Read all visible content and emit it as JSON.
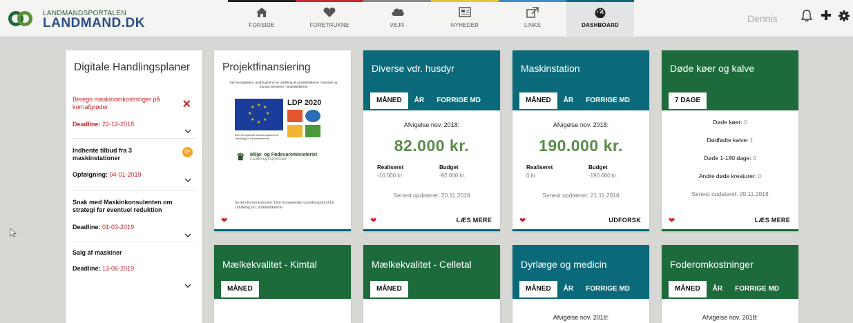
{
  "header": {
    "logo_top": "LANDMANDSPORTALEN",
    "logo_main": "LANDMAND.DK",
    "user": "Dennis",
    "nav": [
      {
        "label": "FORSIDE",
        "icon": "home-icon",
        "color": "#222222"
      },
      {
        "label": "FORETRUKNE",
        "icon": "heart-icon",
        "color": "#d0272b"
      },
      {
        "label": "VEJR",
        "icon": "cloud-icon",
        "color": "#7a7a7a"
      },
      {
        "label": "NYHEDER",
        "icon": "newspaper-icon",
        "color": "#e8c53a"
      },
      {
        "label": "LINKS",
        "icon": "external-link-icon",
        "color": "#3b8ed0"
      },
      {
        "label": "DASHBOARD",
        "icon": "dashboard-icon",
        "color": "#0b6a7a"
      }
    ]
  },
  "plans": {
    "title": "Digitale Handlingsplaner",
    "items": [
      {
        "text": "Beregn maskinomkostninger på kornafgrøder",
        "deadline_label": "Deadline:",
        "deadline": "22-12-2018"
      },
      {
        "text": "Indhente tilbud fra 3 maskinstationer",
        "deadline_label": "Opfølgning:",
        "deadline": "04-01-2019"
      },
      {
        "text": "Snak med Maskinkonsulenten om strategi for eventuel reduktion",
        "deadline_label": "Deadline:",
        "deadline": "01-03-2019"
      },
      {
        "text": "Salg af maskiner",
        "deadline_label": "Deadline:",
        "deadline": "13-06-2019"
      }
    ]
  },
  "proj": {
    "title": "Projektfinansiering",
    "eu_title": "Den Europæiske Landbrugsfond for Udvikling af Landdistrikterne: Danmark og Europa investerer i landdistrikterne",
    "flag_caption": "Den Europæiske Landbrugsfond for Udvikling af Landdistrikterne",
    "ldp": "LDP 2020",
    "ministry": "Miljø- og Fødevareministeriet",
    "agency": "Landbrugsstyrelsen",
    "note": "Se EU-Kommissionen. Den Europæiske Landbrugsfond for Udvikling af Landdistrikterne"
  },
  "husdyr": {
    "title": "Diverse vdr. husdyr",
    "tabs": [
      "MÅNED",
      "ÅR",
      "FORRIGE MD"
    ],
    "period": "Afvigelse nov. 2018:",
    "amount": "82.000 kr.",
    "realiseret_label": "Realiseret",
    "realiseret": "-10.000 kr.",
    "budget_label": "Budget",
    "budget": "-92.000 kr.",
    "updated": "Senest opdateret: 20.11.2018",
    "action": "LÆS MERE"
  },
  "maskin": {
    "title": "Maskinstation",
    "tabs": [
      "MÅNED",
      "ÅR",
      "FORRIGE MD"
    ],
    "period": "Afvigelse nov. 2018:",
    "amount": "190.000 kr.",
    "realiseret_label": "Realiseret",
    "realiseret": "0 kr.",
    "budget_label": "Budget",
    "budget": "-190.000 kr.",
    "updated": "Senest opdateret: 21.11.2018",
    "action": "UDFORSK"
  },
  "doede": {
    "title": "Døde køer og kalve",
    "tabs": [
      "7 DAGE"
    ],
    "stats": [
      {
        "label": "Døde køer:",
        "value": "0"
      },
      {
        "label": "Dødfødte kalve:",
        "value": "1"
      },
      {
        "label": "Døde 1-180 dage:",
        "value": "0"
      },
      {
        "label": "Andre døde kreaturer:",
        "value": "0"
      }
    ],
    "updated": "Senest opdateret: 20.11.2018",
    "action": "LÆS MERE"
  },
  "row2": [
    {
      "title": "Mælkekvalitet - Kimtal",
      "tabs": [
        "MÅNED"
      ],
      "period": ""
    },
    {
      "title": "Mælkekvalitet - Celletal",
      "tabs": [
        "MÅNED"
      ],
      "period": ""
    },
    {
      "title": "Dyrlæge og medicin",
      "tabs": [
        "MÅNED",
        "ÅR",
        "FORRIGE MD"
      ],
      "period": "Afvigelse nov. 2018:"
    },
    {
      "title": "Foderomkostninger",
      "tabs": [
        "MÅNED",
        "ÅR",
        "FORRIGE MD"
      ],
      "period": "Afvigelse nov. 2018:"
    }
  ]
}
